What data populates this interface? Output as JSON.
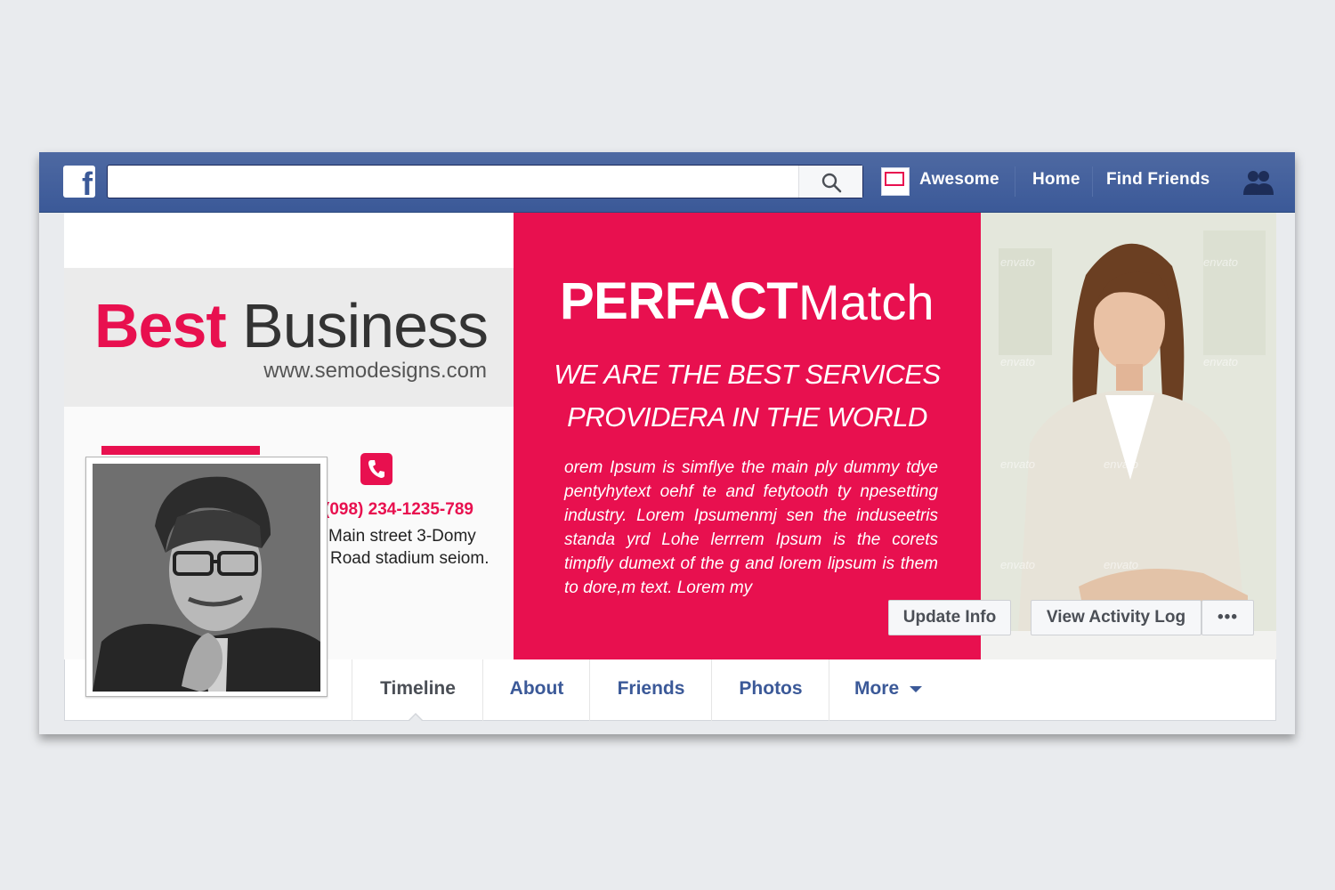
{
  "topbar": {
    "logo_letter": "f",
    "search": {
      "value": "",
      "placeholder": ""
    },
    "nav_links": [
      "Awesome",
      "Home",
      "Find Friends"
    ],
    "icons": [
      "facebook-logo-icon",
      "search-icon",
      "friends-icon"
    ]
  },
  "cover": {
    "brand_best": "Best",
    "brand_business": "Business",
    "brand_url": "www.semodesigns.com",
    "phone": "(098) 234-1235-789",
    "address_line1": "Main street 3-Domy",
    "address_line2": "Road  stadium seiom.",
    "headline_bold": "PERFACT",
    "headline_light": "Match",
    "tagline_line1": "WE ARE THE BEST SERVICES",
    "tagline_line2": "PROVIDERA IN THE WORLD",
    "body_text": "orem Ipsum is simflye the main ply dummy tdye pentyhytext oehf te and  fetytooth ty npesetting industry. Lorem Ipsumenmj sen the induseetris standa yrd  Lohe lerrrem Ipsum is  the  corets timpfly dumext of the g and  lorem lipsum is them to dore,m text. Lorem my",
    "watermark": "envato",
    "accent_color": "#e8104f"
  },
  "buttons": {
    "update_info": "Update Info",
    "view_activity_log": "View Activity Log",
    "more_options": "•••"
  },
  "tabs": {
    "items": [
      "Timeline",
      "About",
      "Friends",
      "Photos",
      "More"
    ],
    "active": "Timeline"
  }
}
